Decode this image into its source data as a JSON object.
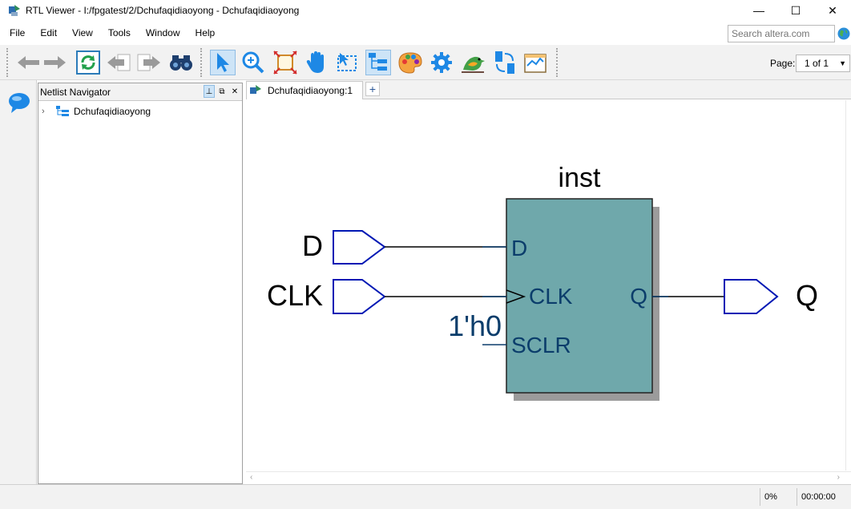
{
  "window": {
    "title": "RTL Viewer - I:/fpgatest/2/Dchufaqidiaoyong - Dchufaqidiaoyong",
    "minimize": "—",
    "maximize": "☐",
    "close": "✕"
  },
  "menu": {
    "items": [
      "File",
      "Edit",
      "View",
      "Tools",
      "Window",
      "Help"
    ],
    "search_placeholder": "Search altera.com"
  },
  "toolbar": {
    "page_label": "Page:",
    "page_value": "1 of 1"
  },
  "navigator": {
    "title": "Netlist Navigator",
    "tree_root": "Dchufaqidiaoyong"
  },
  "tabs": {
    "active": "Dchufaqidiaoyong:1",
    "add": "+"
  },
  "schematic": {
    "instance_name": "inst",
    "inputs": [
      "D",
      "CLK"
    ],
    "output": "Q",
    "ports": {
      "d": "D",
      "clk": "CLK",
      "sclr": "SCLR",
      "q": "Q"
    },
    "constant": "1'h0",
    "colors": {
      "block_fill": "#6fa8ab",
      "block_shadow": "#9b9b9b",
      "port_outline": "#0018b4",
      "port_text": "#0b3d6b"
    }
  },
  "status": {
    "progress": "0%",
    "time": "00:00:00"
  }
}
